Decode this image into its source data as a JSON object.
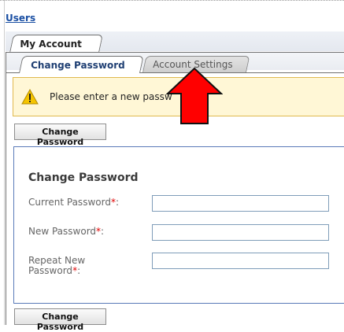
{
  "breadcrumb": "Users",
  "tabs_top": [
    {
      "label": "My Account"
    }
  ],
  "tabs_sub": [
    {
      "label": "Change Password"
    },
    {
      "label": "Account Settings"
    }
  ],
  "warning": {
    "text": "Please enter a new passw"
  },
  "buttons": {
    "change_password_top": "Change Password",
    "change_password_bottom": "Change Password"
  },
  "form": {
    "title": "Change Password",
    "fields": [
      {
        "label": "Current Password",
        "required": "*",
        "colon": ":",
        "value": ""
      },
      {
        "label": "New Password",
        "required": "*",
        "colon": ":",
        "value": ""
      },
      {
        "label_line1": "Repeat New",
        "label_line2": "Password",
        "required": "*",
        "colon": ":",
        "value": ""
      }
    ]
  },
  "colors": {
    "link": "#1a4fa3",
    "required": "#e00000",
    "warning_bg": "#fff7d6",
    "arrow": "#ff0000"
  },
  "icons": {
    "warning": "warning-triangle-icon",
    "annotation": "red-up-arrow"
  }
}
